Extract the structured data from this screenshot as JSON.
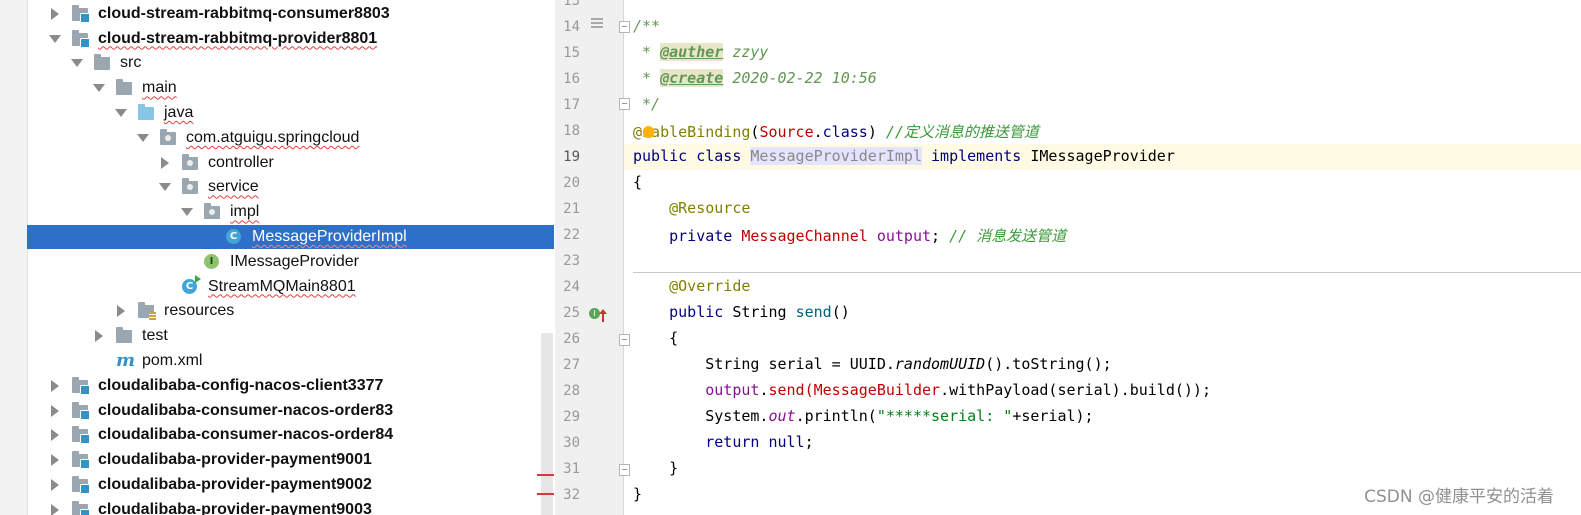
{
  "tree": {
    "items": [
      {
        "label": "cloud-stream-rabbitmq-consumer8803",
        "bold": true,
        "indent": 0,
        "arrow": "right",
        "icon": "module-folder"
      },
      {
        "label": "cloud-stream-rabbitmq-provider8801",
        "bold": true,
        "indent": 0,
        "arrow": "down",
        "icon": "module-folder",
        "squiggle": true
      },
      {
        "label": "src",
        "indent": 1,
        "arrow": "down",
        "icon": "folder"
      },
      {
        "label": "main",
        "indent": 2,
        "arrow": "down",
        "icon": "folder",
        "squiggle": true
      },
      {
        "label": "java",
        "indent": 3,
        "arrow": "down",
        "icon": "source-folder",
        "squiggle": true
      },
      {
        "label": "com.atguigu.springcloud",
        "indent": 4,
        "arrow": "down",
        "icon": "package",
        "squiggle": true
      },
      {
        "label": "controller",
        "indent": 5,
        "arrow": "right",
        "icon": "package"
      },
      {
        "label": "service",
        "indent": 5,
        "arrow": "down",
        "icon": "package",
        "squiggle": true
      },
      {
        "label": "impl",
        "indent": 6,
        "arrow": "down",
        "icon": "package",
        "squiggle": true
      },
      {
        "label": "MessageProviderImpl",
        "indent": 7,
        "icon": "class",
        "selected": true,
        "squiggle": true
      },
      {
        "label": "IMessageProvider",
        "indent": 6,
        "icon": "interface"
      },
      {
        "label": "StreamMQMain8801",
        "indent": 5,
        "icon": "runnable-class",
        "squiggle": true
      },
      {
        "label": "resources",
        "indent": 3,
        "arrow": "right",
        "icon": "resources-folder"
      },
      {
        "label": "test",
        "indent": 2,
        "arrow": "right",
        "icon": "folder"
      },
      {
        "label": "pom.xml",
        "indent": 2,
        "icon": "maven"
      },
      {
        "label": "cloudalibaba-config-nacos-client3377",
        "bold": true,
        "indent": 0,
        "arrow": "right",
        "icon": "module-folder"
      },
      {
        "label": "cloudalibaba-consumer-nacos-order83",
        "bold": true,
        "indent": 0,
        "arrow": "right",
        "icon": "module-folder"
      },
      {
        "label": "cloudalibaba-consumer-nacos-order84",
        "bold": true,
        "indent": 0,
        "arrow": "right",
        "icon": "module-folder"
      },
      {
        "label": "cloudalibaba-provider-payment9001",
        "bold": true,
        "indent": 0,
        "arrow": "right",
        "icon": "module-folder"
      },
      {
        "label": "cloudalibaba-provider-payment9002",
        "bold": true,
        "indent": 0,
        "arrow": "right",
        "icon": "module-folder"
      },
      {
        "label": "cloudalibaba-provider-payment9003",
        "bold": true,
        "indent": 0,
        "arrow": "right",
        "icon": "module-folder"
      }
    ]
  },
  "editor": {
    "line_numbers": [
      "13",
      "14",
      "15",
      "16",
      "17",
      "18",
      "19",
      "20",
      "21",
      "22",
      "23",
      "24",
      "25",
      "26",
      "27",
      "28",
      "29",
      "30",
      "31",
      "32"
    ],
    "current_line": "19",
    "lines": {
      "l14": {
        "t1": "/**"
      },
      "l15": {
        "t1": " * ",
        "t2": "@auther",
        "t3": " zzyy"
      },
      "l16": {
        "t1": " * ",
        "t2": "@create",
        "t3": " 2020-02-22 10:56"
      },
      "l17": {
        "t1": " */"
      },
      "l18": {
        "t1": "@",
        "t2": "nableBinding",
        "t3": "(",
        "t4": "Source",
        "t5": ".",
        "t6": "class",
        "t7": ") ",
        "t8": "//定义消息的推送管道"
      },
      "l19": {
        "t1": "public class ",
        "t2": "MessageProviderImpl",
        "t3": " implements ",
        "t4": "IMessageProvider"
      },
      "l20": {
        "t1": "{"
      },
      "l21": {
        "t1": "    @Resource"
      },
      "l22": {
        "t1": "    private ",
        "t2": "MessageChannel",
        "t3": " output",
        "t4": "; ",
        "t5": "// 消息发送管道"
      },
      "l24": {
        "t1": "    @Override"
      },
      "l25": {
        "t1": "    public ",
        "t2": "String ",
        "t3": "send",
        "t4": "()"
      },
      "l26": {
        "t1": "    {"
      },
      "l27": {
        "t1": "        String serial = UUID.",
        "t2": "randomUUID",
        "t3": "().toString();"
      },
      "l28": {
        "t1": "        ",
        "t2": "output",
        "t3": ".",
        "t4": "send",
        "t5": "(",
        "t6": "MessageBuilder",
        "t7": ".withPayload(serial).build());"
      },
      "l29": {
        "t1": "        System.",
        "t2": "out",
        "t3": ".println(",
        "t4": "\"*****serial: \"",
        "t5": "+serial);"
      },
      "l30": {
        "t1": "        ",
        "t2": "return null",
        "t3": ";"
      },
      "l31": {
        "t1": "    }"
      },
      "l32": {
        "t1": "}"
      }
    }
  },
  "watermark": "CSDN @健康平安的活着",
  "colors": {
    "selection": "#2e70c8",
    "current_line": "#fffae3",
    "keyword": "#000080",
    "annotation": "#808000",
    "comment": "#3a9a3a",
    "field": "#871094",
    "error": "#c00000"
  }
}
